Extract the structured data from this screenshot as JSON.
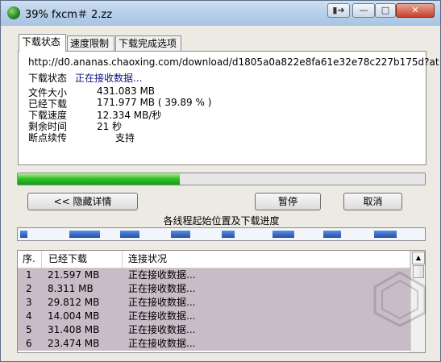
{
  "window": {
    "title": "39% fxcm＃ 2.zz"
  },
  "tabs": [
    {
      "label": "下载状态"
    },
    {
      "label": "速度限制"
    },
    {
      "label": "下载完成选项"
    }
  ],
  "info": {
    "url": "http://d0.ananas.chaoxing.com/download/d1805a0a822e8fa61e32e78c227b175d?at",
    "status_label": "下载状态",
    "status_value": "正在接收数据...",
    "size_label": "文件大小",
    "size_value": "431.083  MB",
    "downloaded_label": "已经下载",
    "downloaded_value": "171.977  MB  ( 39.89 % )",
    "speed_label": "下载速度",
    "speed_value": "12.334  MB/秒",
    "remaining_label": "剩余时间",
    "remaining_value": "21 秒",
    "resume_label": "断点续传",
    "resume_value": "支持"
  },
  "progress": {
    "percent": 39.89
  },
  "buttons": {
    "hide_details": "<< 隐藏详情",
    "pause": "暂停",
    "cancel": "取消"
  },
  "threads": {
    "title": "各线程起始位置及下载进度"
  },
  "list": {
    "columns": [
      "序.",
      "已经下载",
      "连接状况"
    ],
    "rows": [
      {
        "no": "1",
        "downloaded": "21.597 MB",
        "status": "正在接收数据..."
      },
      {
        "no": "2",
        "downloaded": "8.311 MB",
        "status": "正在接收数据..."
      },
      {
        "no": "3",
        "downloaded": "29.812 MB",
        "status": "正在接收数据..."
      },
      {
        "no": "4",
        "downloaded": "14.004 MB",
        "status": "正在接收数据..."
      },
      {
        "no": "5",
        "downloaded": "31.408 MB",
        "status": "正在接收数据..."
      },
      {
        "no": "6",
        "downloaded": "23.474 MB",
        "status": "正在接收数据..."
      }
    ]
  },
  "colors": {
    "progress_green": "#2fbf2a",
    "thread_blue": "#2f63c2",
    "row_bg": "#c9bcc7"
  }
}
